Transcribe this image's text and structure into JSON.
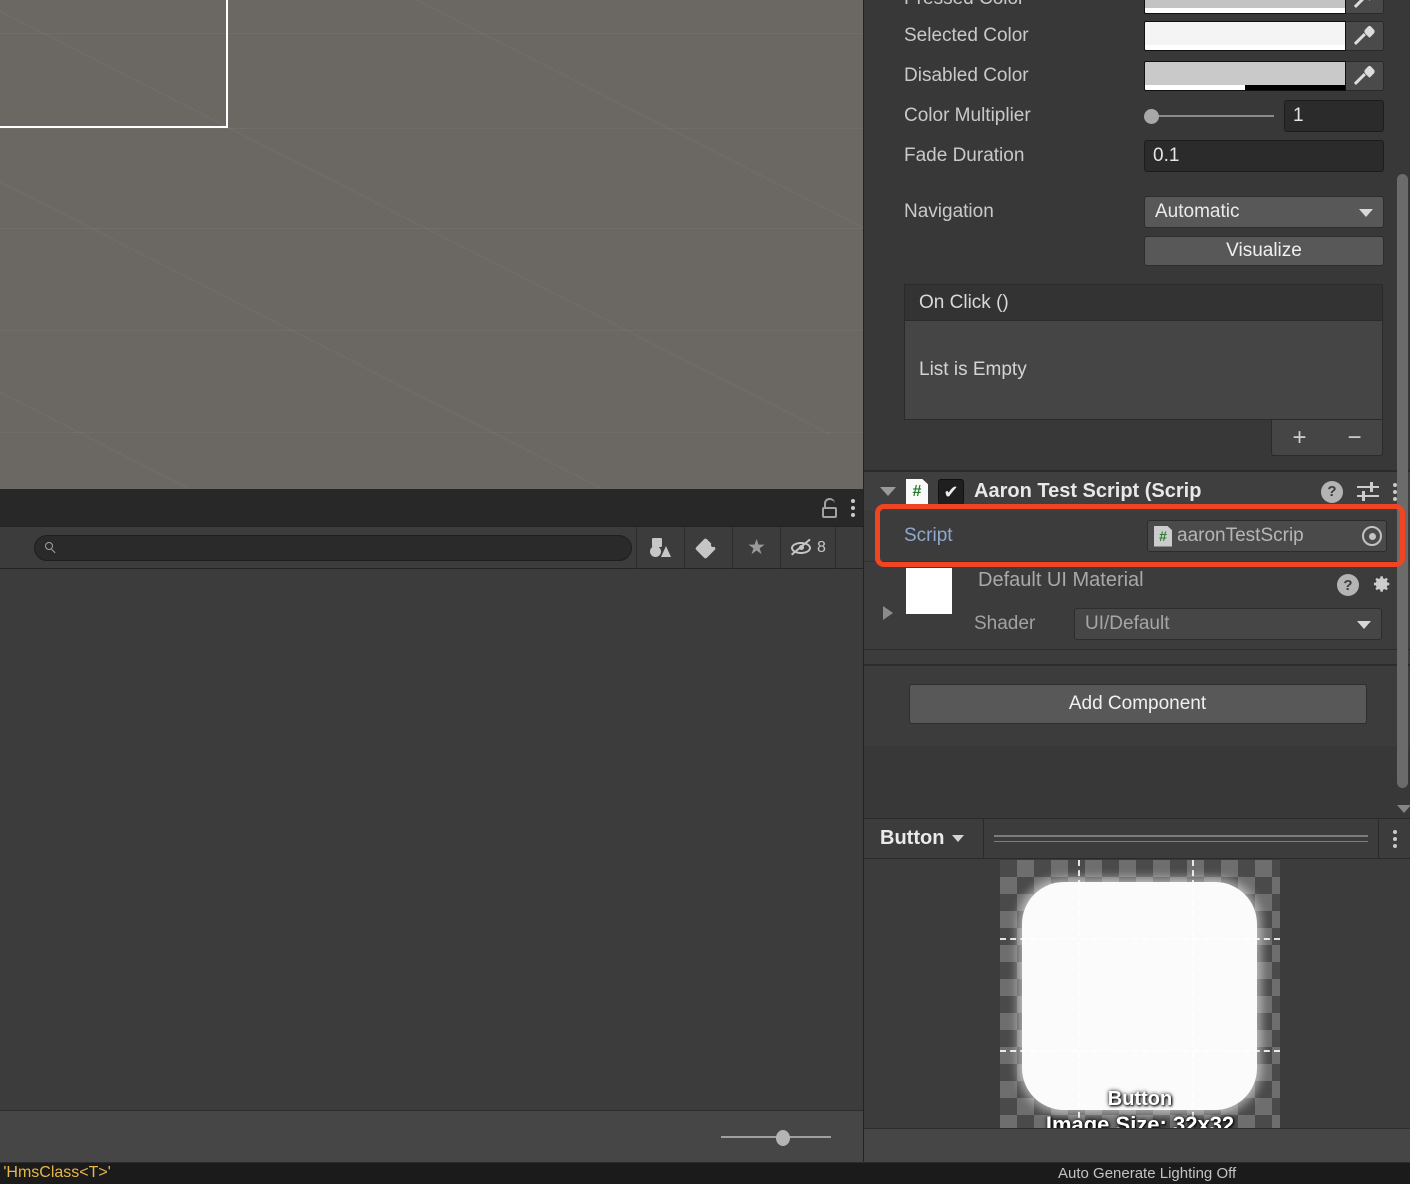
{
  "scene": {
    "name": "scene-view",
    "background_color": "#6b6763",
    "selection_outline_color": "#ffffff"
  },
  "project_panel": {
    "lock_icon": "lock-open-icon",
    "menu_icon": "kebab-menu-icon",
    "search": {
      "value": "",
      "placeholder": "",
      "icon": "search-icon"
    },
    "filters": [
      {
        "icon": "shapes-filter-icon",
        "label": "Search by Type"
      },
      {
        "icon": "tag-filter-icon",
        "label": "Search by Label"
      },
      {
        "icon": "star-favorites-icon",
        "label": "Favorites"
      },
      {
        "icon": "hidden-eye-icon",
        "label": "Hidden",
        "count": "8"
      }
    ],
    "zoom_slider": {
      "value": 50
    }
  },
  "status_bar": {
    "message": "n 'HmsClass<T>'",
    "message_color": "#e7b64b",
    "right_message": "Auto Generate Lighting Off"
  },
  "inspector": {
    "selectable_colors": [
      {
        "label": "Pressed Color",
        "swatch": "#c3c3c3",
        "alpha_pct": 100,
        "eyedropper": "eyedropper-icon"
      },
      {
        "label": "Selected Color",
        "swatch": "#f4f4f4",
        "alpha_pct": 100,
        "eyedropper": "eyedropper-icon"
      },
      {
        "label": "Disabled Color",
        "swatch": "#c9c9c9",
        "alpha_pct": 50,
        "eyedropper": "eyedropper-icon"
      }
    ],
    "color_multiplier": {
      "label": "Color Multiplier",
      "value": "1",
      "slider_pct": 0
    },
    "fade_duration": {
      "label": "Fade Duration",
      "value": "0.1"
    },
    "navigation": {
      "label": "Navigation",
      "value": "Automatic",
      "caret": "chevron-down-icon"
    },
    "visualize_button": "Visualize",
    "on_click": {
      "header": "On Click ()",
      "empty_text": "List is Empty",
      "add_label": "+",
      "remove_label": "−"
    },
    "script_component": {
      "foldout": "triangle-down-icon",
      "type_icon": "csharp-script-icon",
      "enabled": true,
      "checkmark": "✔",
      "title": "Aaron Test Script (Scrip",
      "help_icon": "help-icon",
      "help_glyph": "?",
      "preset_icon": "preset-sliders-icon",
      "menu_icon": "kebab-menu-icon",
      "script_field": {
        "label": "Script",
        "value": "aaronTestScrip",
        "type_icon": "csharp-script-icon",
        "picker_icon": "object-picker-icon"
      },
      "highlight_color": "#ef4523"
    },
    "material": {
      "foldout": "triangle-right-icon",
      "name": "Default UI Material",
      "swatch_color": "#ffffff",
      "help_icon": "help-icon",
      "help_glyph": "?",
      "settings_icon": "gear-icon",
      "shader_label": "Shader",
      "shader_value": "UI/Default",
      "caret": "chevron-down-icon"
    },
    "add_component_button": "Add Component",
    "scrollbar": {
      "name": "inspector-scrollbar"
    }
  },
  "preview": {
    "dropdown_value": "Button",
    "caret": "chevron-down-icon",
    "drag_handle": "drag-handle-icon",
    "menu_icon": "kebab-menu-icon",
    "sprite_name": "Button",
    "image_size": "Image Size: 32x32"
  }
}
